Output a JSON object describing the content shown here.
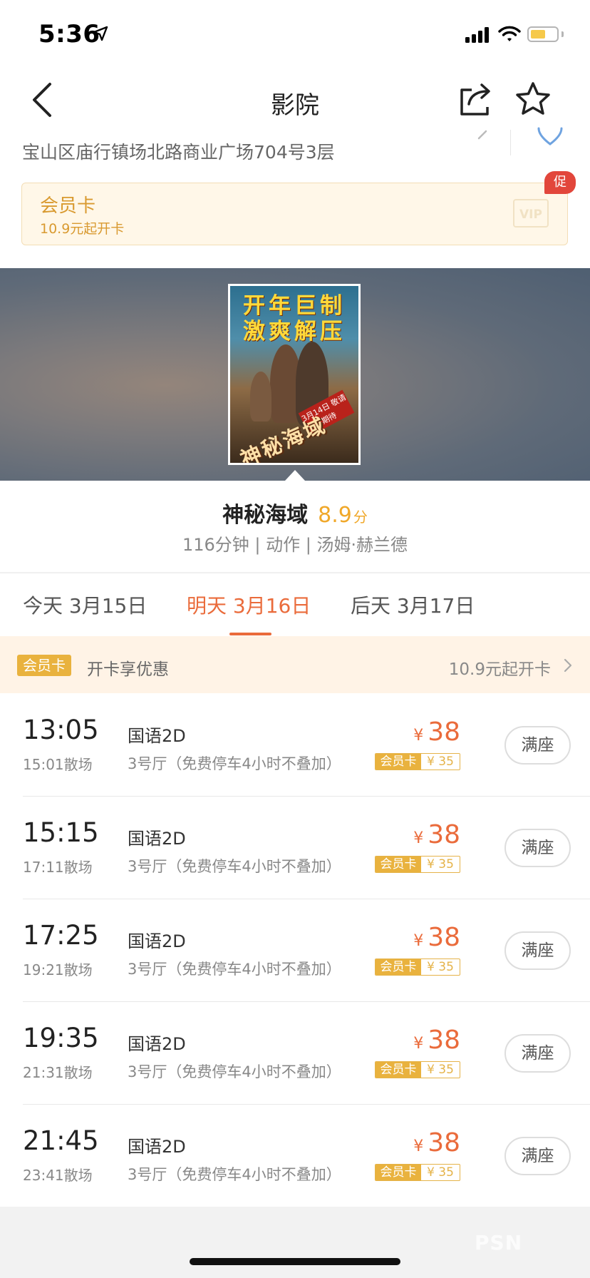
{
  "status_bar": {
    "time": "5:36"
  },
  "nav": {
    "title": "影院"
  },
  "cinema": {
    "address": "宝山区庙行镇场北路商业广场704号3层"
  },
  "member_card": {
    "title": "会员卡",
    "subtitle": "10.9元起开卡",
    "logo_text": "VIP",
    "badge": "促"
  },
  "poster": {
    "line1": "开年巨制",
    "line2": "激爽解压",
    "title_art": "神秘海域",
    "release_tag": "3月14日 敬请期待"
  },
  "movie": {
    "title": "神秘海域",
    "score": "8.9",
    "score_unit": "分",
    "meta": "116分钟 | 动作 | 汤姆·赫兰德"
  },
  "date_tabs": [
    {
      "label": "今天 3月15日",
      "active": false
    },
    {
      "label": "明天 3月16日",
      "active": true
    },
    {
      "label": "后天 3月17日",
      "active": false
    }
  ],
  "member_promo": {
    "tag": "会员卡",
    "text": "开卡享优惠",
    "action": "10.9元起开卡"
  },
  "showtimes": [
    {
      "start": "13:05",
      "end": "15:01散场",
      "lang": "国语2D",
      "hall": "3号厅（免费停车4小时不叠加）",
      "currency": "¥",
      "price": "38",
      "member_label": "会员卡",
      "member_price": "¥ 35",
      "status": "满座"
    },
    {
      "start": "15:15",
      "end": "17:11散场",
      "lang": "国语2D",
      "hall": "3号厅（免费停车4小时不叠加）",
      "currency": "¥",
      "price": "38",
      "member_label": "会员卡",
      "member_price": "¥ 35",
      "status": "满座"
    },
    {
      "start": "17:25",
      "end": "19:21散场",
      "lang": "国语2D",
      "hall": "3号厅（免费停车4小时不叠加）",
      "currency": "¥",
      "price": "38",
      "member_label": "会员卡",
      "member_price": "¥ 35",
      "status": "满座"
    },
    {
      "start": "19:35",
      "end": "21:31散场",
      "lang": "国语2D",
      "hall": "3号厅（免费停车4小时不叠加）",
      "currency": "¥",
      "price": "38",
      "member_label": "会员卡",
      "member_price": "¥ 35",
      "status": "满座"
    },
    {
      "start": "21:45",
      "end": "23:41散场",
      "lang": "国语2D",
      "hall": "3号厅（免费停车4小时不叠加）",
      "currency": "¥",
      "price": "38",
      "member_label": "会员卡",
      "member_price": "¥ 35",
      "status": "满座"
    }
  ],
  "watermark": "PSN",
  "colors": {
    "accent": "#ea6b3b",
    "gold": "#e9b23e",
    "score": "#f0a82a",
    "badge_red": "#e2463b"
  },
  "icons": [
    "location-arrow-icon",
    "signal-icon",
    "wifi-icon",
    "battery-icon",
    "back-icon",
    "share-icon",
    "star-icon",
    "chevron-right-icon",
    "map-pin-icon"
  ]
}
